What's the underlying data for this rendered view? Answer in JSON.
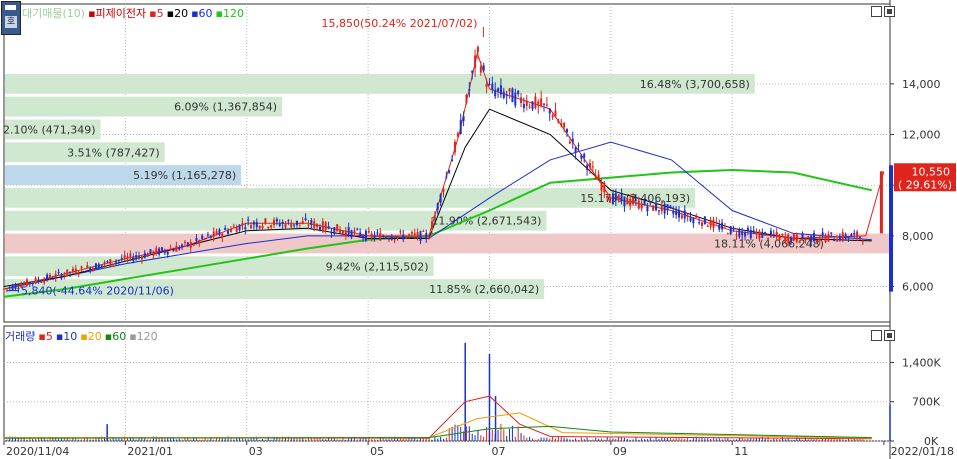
{
  "title_bar": {
    "item_prefix": "▪",
    "item_name": "피제이전자",
    "item_blur": "대기매물(10)",
    "ma_labels": [
      "5",
      "20",
      "60",
      "120"
    ],
    "ma_colors": [
      "#e0241b",
      "#000000",
      "#1a2fcc",
      "#21c418"
    ]
  },
  "volume_bar": {
    "name": "거래량",
    "ma_labels": [
      "5",
      "10",
      "20",
      "60",
      "120"
    ],
    "ma_colors": [
      "#e0241b",
      "#1a2fcc",
      "#f0a000",
      "#118811",
      "#999999"
    ]
  },
  "corner_icon": "chart-menu-icon",
  "corner_glyph": "호",
  "annotations": {
    "high": "15,850(50.24% 2021/07/02)",
    "low": "5,840(-44.64% 2020/11/06)",
    "price_tag_value": "10,550",
    "price_tag_change": "( 29.61%)"
  },
  "chart_data": [
    {
      "type": "bar",
      "title": "",
      "chart_role": "volume-profile (대기매물)",
      "orientation": "horizontal",
      "bands": [
        {
          "price_low": 13550,
          "price_high": 14450,
          "label": "16.48% (3,700,658)",
          "percent": 16.48,
          "volume": 3700658
        },
        {
          "price_low": 12650,
          "price_high": 13550,
          "label": "6.09% (1,367,854)",
          "percent": 6.09,
          "volume": 1367854
        },
        {
          "price_low": 11750,
          "price_high": 12650,
          "label": "2.10% (471,349)",
          "percent": 2.1,
          "volume": 471349
        },
        {
          "price_low": 10850,
          "price_high": 11750,
          "label": "3.51% (787,427)",
          "percent": 3.51,
          "volume": 787427
        },
        {
          "price_low": 9950,
          "price_high": 10850,
          "label": "5.19% (1,165,278)",
          "percent": 5.19,
          "volume": 1165278,
          "highlight": "current"
        },
        {
          "price_low": 9050,
          "price_high": 9950,
          "label": "15.17% (3,406,193)",
          "percent": 15.17,
          "volume": 3406193
        },
        {
          "price_low": 8150,
          "price_high": 9050,
          "label": "11.90% (2,671,543)",
          "percent": 11.9,
          "volume": 2671543
        },
        {
          "price_low": 7250,
          "price_high": 8150,
          "label": "18.11% (4,066,248)",
          "percent": 18.11,
          "volume": 4066248,
          "highlight": "max"
        },
        {
          "price_low": 6350,
          "price_high": 7250,
          "label": "9.42% (2,115,502)",
          "percent": 9.42,
          "volume": 2115502
        },
        {
          "price_low": 5450,
          "price_high": 6350,
          "label": "11.85% (2,660,042)",
          "percent": 11.85,
          "volume": 2660042
        }
      ]
    },
    {
      "type": "line",
      "title": "피제이전자",
      "chart_role": "price candlestick with moving averages",
      "ylim": [
        4600,
        16600
      ],
      "y_ticks": [
        6000,
        8000,
        10000,
        12000,
        14000
      ],
      "y_tick_labels": [
        "6,000",
        "8,000",
        "10,000",
        "12,000",
        "14,000"
      ],
      "x_tick_labels": [
        "2020/11/04",
        "2021/01",
        "03",
        "05",
        "07",
        "09",
        "11",
        "2022/01/18"
      ],
      "x_tick_months": [
        0,
        2,
        4,
        6,
        8,
        10,
        12,
        14.5
      ],
      "grid": true,
      "series": [
        {
          "name": "120",
          "color": "#21c418",
          "x": [
            0,
            1,
            2,
            3,
            4,
            5,
            6,
            7,
            8,
            9,
            10,
            11,
            12,
            13,
            14.3
          ],
          "y": [
            5600,
            5900,
            6300,
            6700,
            7100,
            7500,
            7850,
            8000,
            9000,
            10100,
            10300,
            10500,
            10600,
            10500,
            9800
          ]
        },
        {
          "name": "60",
          "color": "#1a2fcc",
          "x": [
            0,
            1,
            2,
            3,
            4,
            5,
            6,
            7,
            8,
            9,
            10,
            11,
            12,
            13,
            14.3
          ],
          "y": [
            5900,
            6400,
            6900,
            7300,
            7700,
            8000,
            8000,
            7900,
            9500,
            11000,
            11700,
            11000,
            9000,
            8100,
            7850
          ]
        },
        {
          "name": "20",
          "color": "#000000",
          "x": [
            0,
            1,
            2,
            3,
            4,
            5,
            6,
            7,
            7.6,
            8,
            9,
            10,
            11,
            12,
            13,
            14.3
          ],
          "y": [
            6000,
            6400,
            7000,
            7600,
            8200,
            8300,
            7900,
            7900,
            11500,
            13000,
            12000,
            9800,
            9100,
            8300,
            7900,
            7800
          ]
        },
        {
          "name": "5",
          "color": "#e0241b",
          "x": [
            0,
            1,
            2,
            3,
            4,
            5,
            6,
            7,
            7.5,
            7.8,
            8,
            9,
            10,
            11,
            12,
            13,
            14.2,
            14.5
          ],
          "y": [
            5900,
            6500,
            7100,
            7600,
            8500,
            8500,
            8000,
            8000,
            12000,
            15200,
            13800,
            13000,
            9500,
            9000,
            8200,
            7900,
            8000,
            10550
          ]
        }
      ],
      "high": {
        "value": 15850,
        "date": "2021/07/02",
        "change_pct": 50.24
      },
      "low": {
        "value": 5840,
        "date": "2020/11/06",
        "change_pct": -44.64
      },
      "last": {
        "value": 10550,
        "change_pct": 29.61
      }
    },
    {
      "type": "bar",
      "title": "거래량",
      "ylim": [
        0,
        1800000
      ],
      "y_ticks": [
        0,
        700000,
        1400000
      ],
      "y_tick_labels": [
        "0K",
        "700K",
        "1,400K"
      ],
      "peaks": [
        {
          "x": 1.7,
          "value": 300000
        },
        {
          "x": 7.6,
          "value": 1750000
        },
        {
          "x": 8.0,
          "value": 1550000
        },
        {
          "x": 8.1,
          "value": 800000
        },
        {
          "x": 14.6,
          "value": 650000
        }
      ]
    }
  ]
}
